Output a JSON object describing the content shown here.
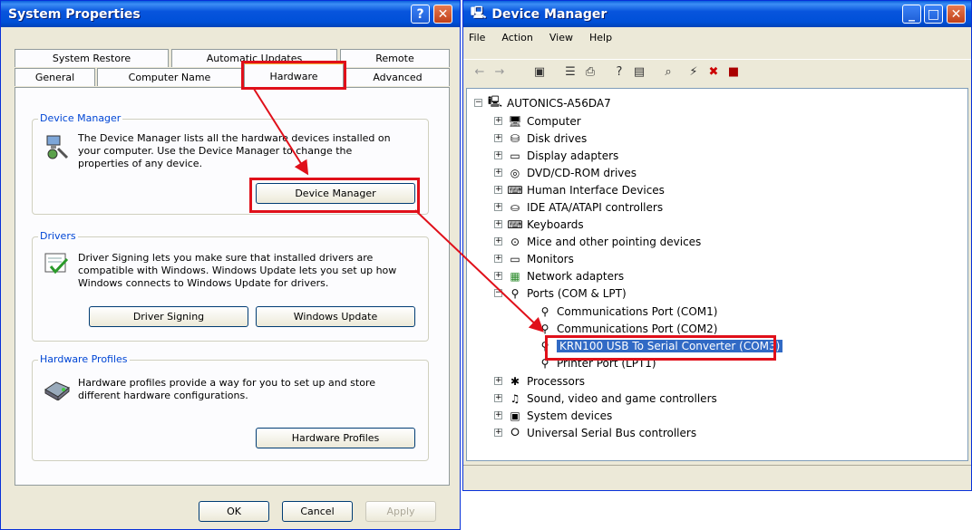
{
  "sys": {
    "title": "System Properties",
    "help_glyph": "?",
    "close_glyph": "✕",
    "tabs_back": [
      "System Restore",
      "Automatic Updates",
      "Remote"
    ],
    "tabs_front": [
      "General",
      "Computer Name",
      "Hardware",
      "Advanced"
    ],
    "device_manager": {
      "title": "Device Manager",
      "text": "The Device Manager lists all the hardware devices installed on your computer. Use the Device Manager to change the properties of any device.",
      "button": "Device Manager"
    },
    "drivers": {
      "title": "Drivers",
      "text": "Driver Signing lets you make sure that installed drivers are compatible with Windows. Windows Update lets you set up how Windows connects to Windows Update for drivers.",
      "signing_button": "Driver Signing",
      "update_button": "Windows Update"
    },
    "profiles": {
      "title": "Hardware Profiles",
      "text": "Hardware profiles provide a way for you to set up and store different hardware configurations.",
      "button": "Hardware Profiles"
    },
    "ok": "OK",
    "cancel": "Cancel",
    "apply": "Apply"
  },
  "dm": {
    "title": "Device Manager",
    "menu": [
      "File",
      "Action",
      "View",
      "Help"
    ],
    "root": "AUTONICS-A56DA7",
    "categories": [
      "Computer",
      "Disk drives",
      "Display adapters",
      "DVD/CD-ROM drives",
      "Human Interface Devices",
      "IDE ATA/ATAPI controllers",
      "Keyboards",
      "Mice and other pointing devices",
      "Monitors",
      "Network adapters",
      "Ports (COM & LPT)"
    ],
    "ports": [
      "Communications Port (COM1)",
      "Communications Port (COM2)",
      "KRN100 USB To Serial Converter (COM3)",
      "Printer Port (LPT1)"
    ],
    "categories_after": [
      "Processors",
      "Sound, video and game controllers",
      "System devices",
      "Universal Serial Bus controllers"
    ]
  },
  "colors": {
    "highlight": "#e0101a",
    "selection": "#316ac5",
    "xp_title": "#0050d8"
  }
}
